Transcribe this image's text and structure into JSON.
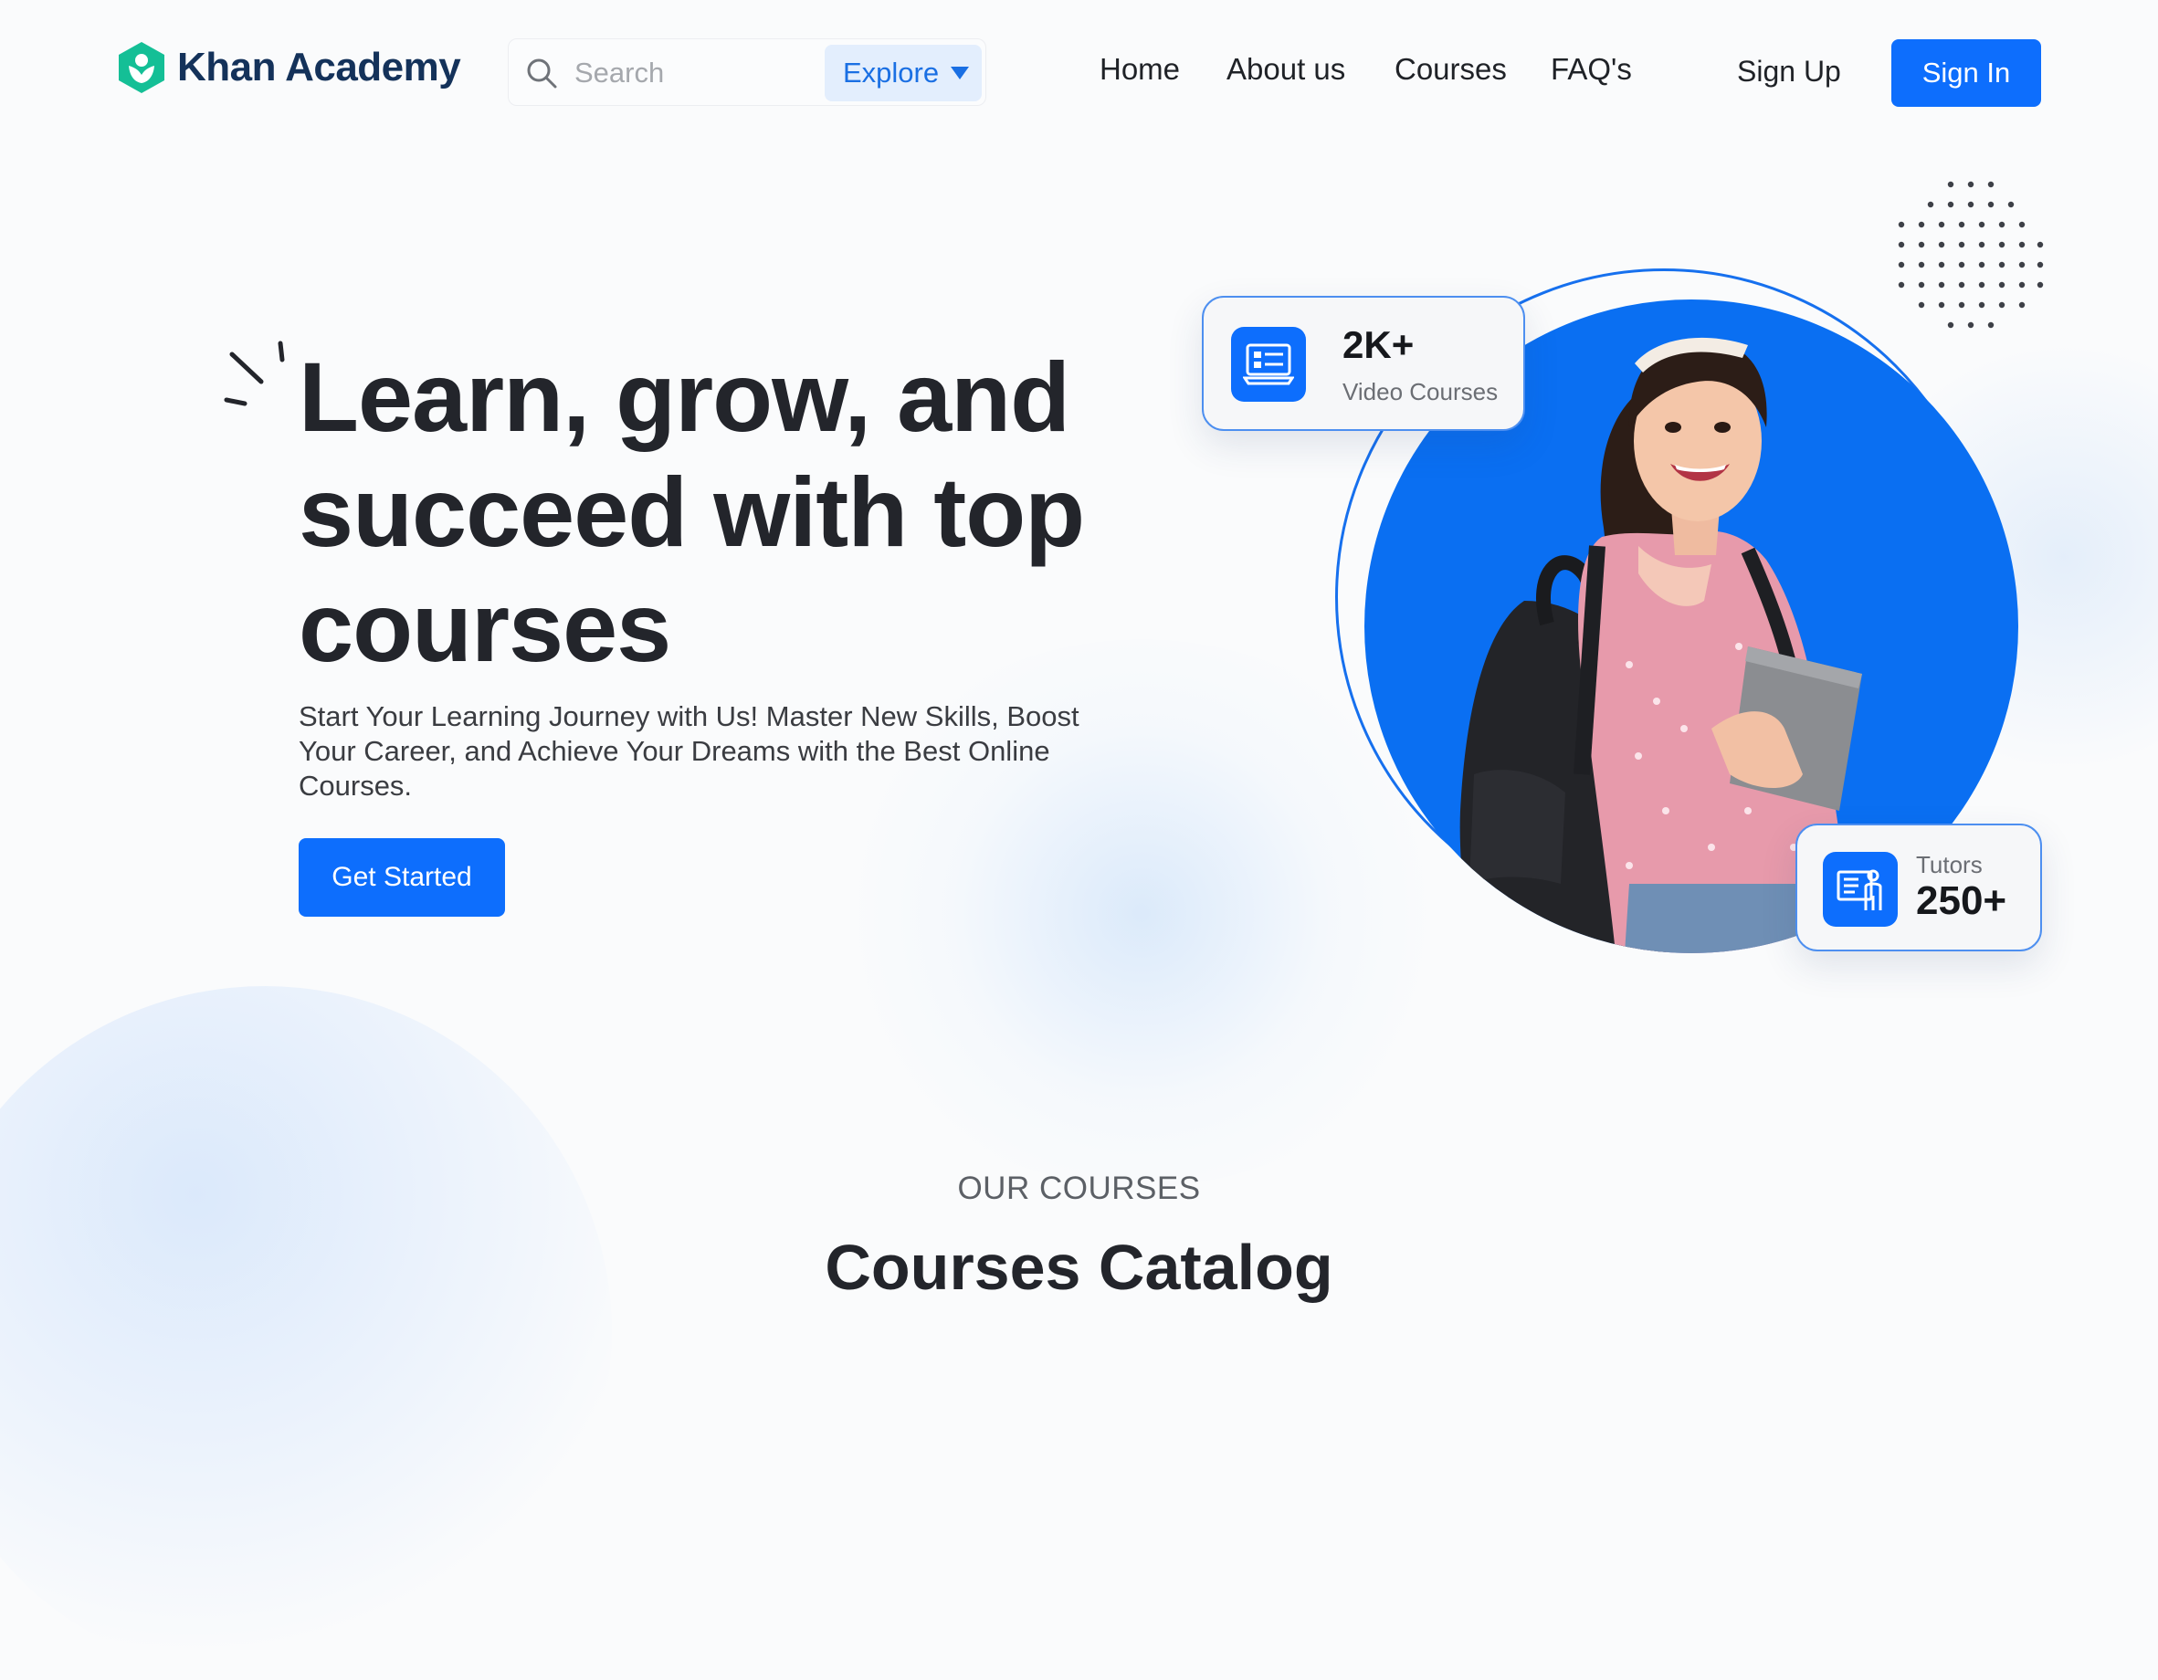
{
  "header": {
    "brand": "Khan Academy",
    "search": {
      "placeholder": "Search",
      "explore_label": "Explore"
    },
    "nav": [
      "Home",
      "About us",
      "Courses",
      "FAQ's"
    ],
    "sign_up": "Sign Up",
    "sign_in": "Sign In"
  },
  "hero": {
    "title": "Learn, grow, and succeed with top courses",
    "subtitle": "Start Your Learning Journey with Us! Master New Skills, Boost Your Career, and Achieve Your Dreams with the Best Online Courses.",
    "cta": "Get Started"
  },
  "stats": {
    "courses": {
      "value": "2K+",
      "label": "Video Courses",
      "icon": "video-course-icon"
    },
    "tutors": {
      "value": "250+",
      "label": "Tutors",
      "icon": "tutor-icon"
    }
  },
  "section": {
    "eyebrow": "OUR COURSES",
    "title": "Courses Catalog"
  },
  "colors": {
    "primary": "#0d6efd",
    "brand": "#14bf96",
    "brand_text": "#14325a"
  }
}
